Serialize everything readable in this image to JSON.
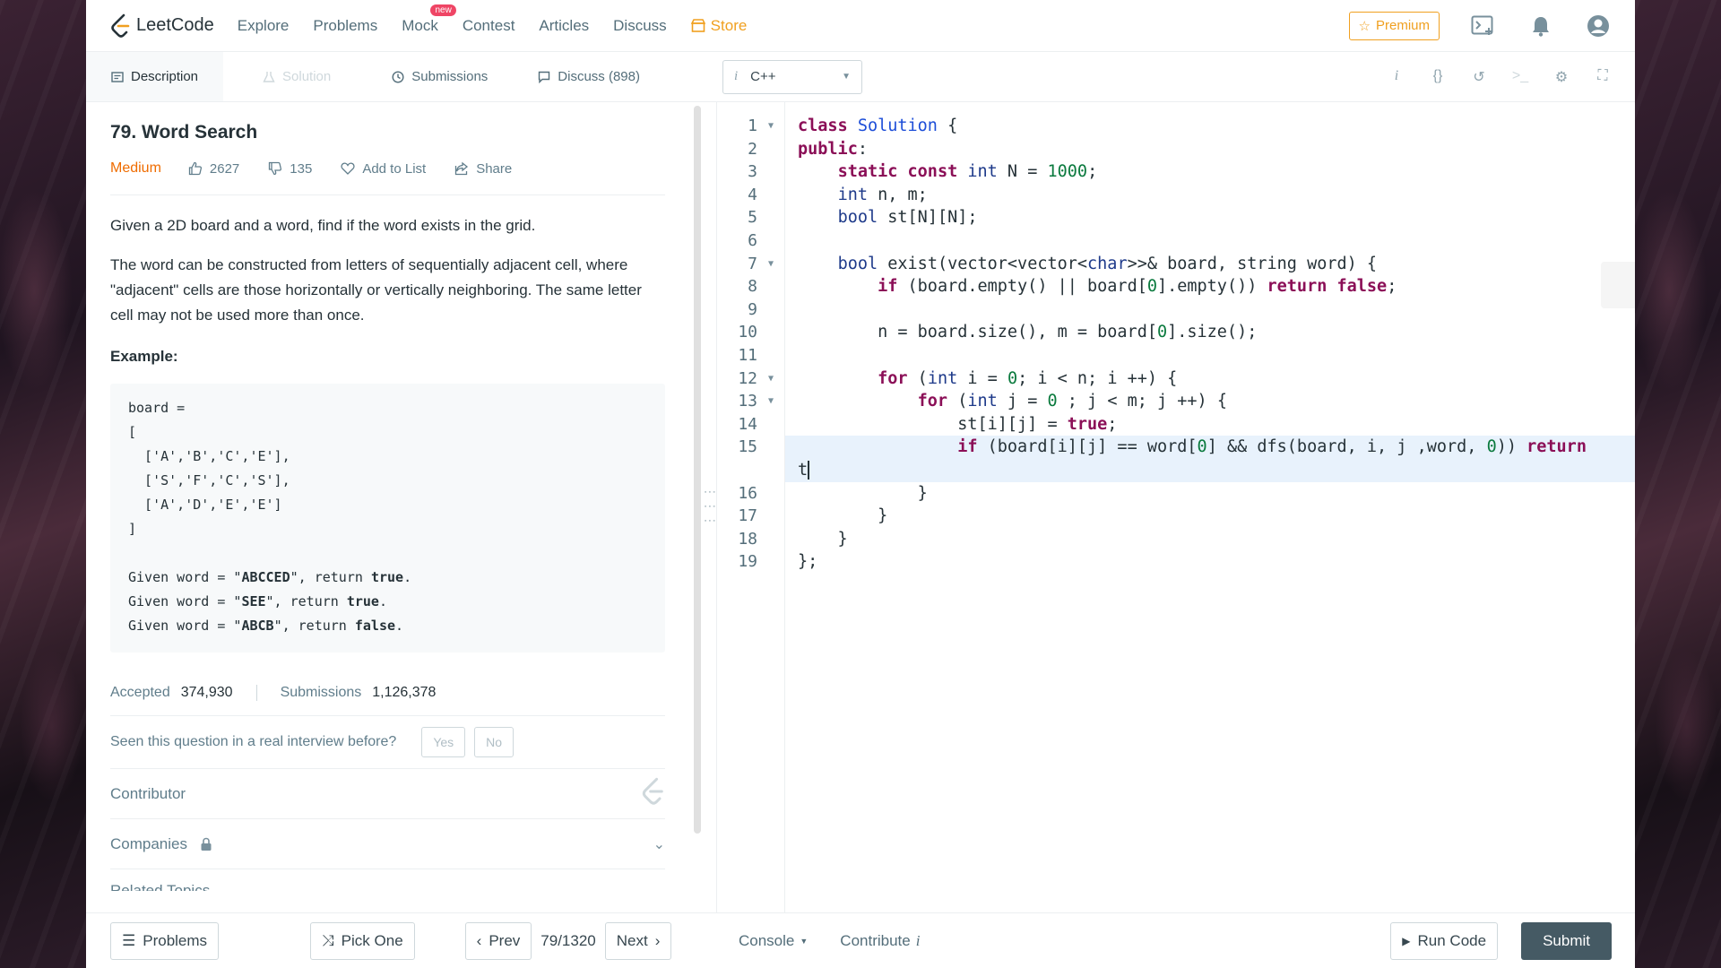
{
  "navbar": {
    "logo_text": "LeetCode",
    "items": [
      "Explore",
      "Problems",
      "Mock",
      "Contest",
      "Articles",
      "Discuss"
    ],
    "mock_badge": "new",
    "store": "Store",
    "premium": "Premium"
  },
  "tabs": {
    "description": "Description",
    "solution": "Solution",
    "submissions": "Submissions",
    "discuss": "Discuss (898)"
  },
  "language": {
    "selected": "C++",
    "info_glyph": "i"
  },
  "question": {
    "title": "79. Word Search",
    "difficulty": "Medium",
    "likes": "2627",
    "dislikes": "135",
    "add_to_list": "Add to List",
    "share": "Share",
    "para1": "Given a 2D board and a word, find if the word exists in the grid.",
    "para2": "The word can be constructed from letters of sequentially adjacent cell, where \"adjacent\" cells are those horizontally or vertically neighboring. The same letter cell may not be used more than once.",
    "example_label": "Example:",
    "example_lines": [
      "board =",
      "[",
      "  ['A','B','C','E'],",
      "  ['S','F','C','S'],",
      "  ['A','D','E','E']",
      "]",
      "",
      "Given word = \"ABCCED\", return true.",
      "Given word = \"SEE\", return true.",
      "Given word = \"ABCB\", return false."
    ]
  },
  "stats": {
    "accepted_label": "Accepted",
    "accepted": "374,930",
    "submissions_label": "Submissions",
    "submissions": "1,126,378"
  },
  "interview": {
    "question": "Seen this question in a real interview before?",
    "yes": "Yes",
    "no": "No"
  },
  "contributor": "Contributor",
  "companies": "Companies",
  "related_cut": "Related Topics",
  "editor": {
    "line_numbers": [
      "1",
      "2",
      "3",
      "4",
      "5",
      "6",
      "7",
      "8",
      "9",
      "10",
      "11",
      "12",
      "13",
      "14",
      "15",
      "",
      "16",
      "17",
      "18",
      "19"
    ],
    "fold_lines": [
      "1",
      "7",
      "12",
      "13"
    ]
  },
  "bottom": {
    "problems": "Problems",
    "pick_one": "Pick One",
    "prev": "Prev",
    "page": "79/1320",
    "next": "Next",
    "console": "Console",
    "contribute": "Contribute",
    "run_code": "Run Code",
    "submit": "Submit"
  }
}
